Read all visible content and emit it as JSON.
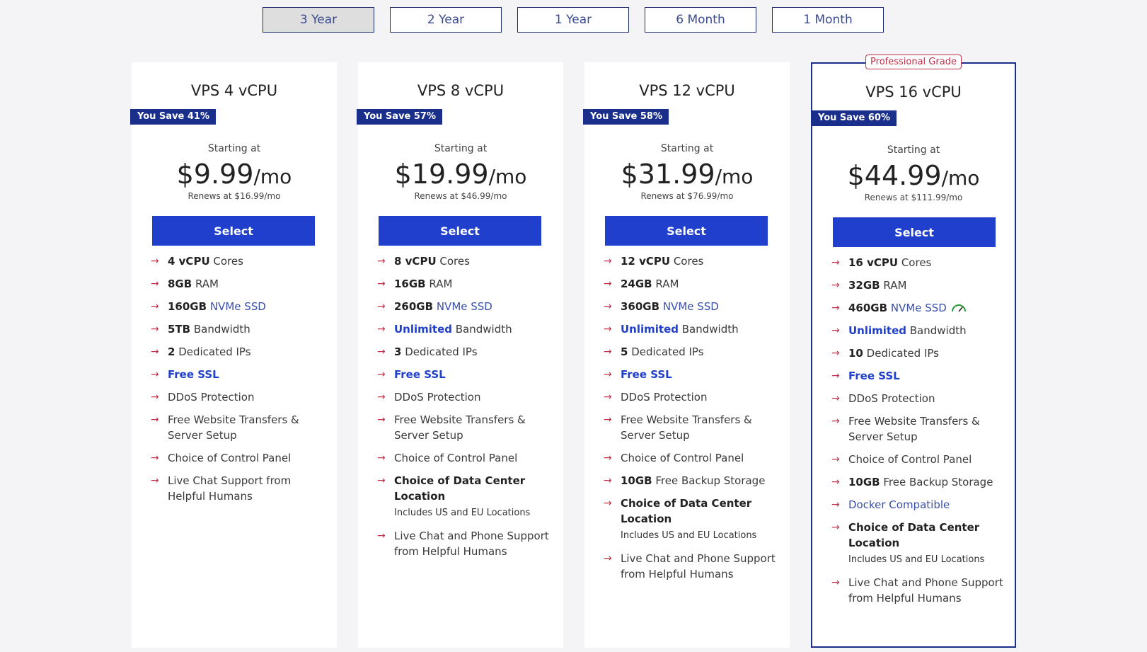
{
  "tabs": [
    {
      "label": "3 Year",
      "active": true
    },
    {
      "label": "2 Year",
      "active": false
    },
    {
      "label": "1 Year",
      "active": false
    },
    {
      "label": "6 Month",
      "active": false
    },
    {
      "label": "1 Month",
      "active": false
    }
  ],
  "plans": [
    {
      "title": "VPS 4 vCPU",
      "save": "You Save 41%",
      "starting": "Starting at",
      "price": "$9.99",
      "per": "/mo",
      "renews": "Renews at $16.99/mo",
      "select": "Select",
      "features": [
        {
          "strong": "4 vCPU",
          "rest": " Cores"
        },
        {
          "strong": "8GB",
          "rest": " RAM"
        },
        {
          "strong": "160GB",
          "rest_blue": " NVMe SSD"
        },
        {
          "strong": "5TB",
          "rest": " Bandwidth"
        },
        {
          "strong": "2",
          "rest": " Dedicated IPs"
        },
        {
          "blue_bold": "Free SSL"
        },
        {
          "rest": "DDoS Protection"
        },
        {
          "rest": "Free Website Transfers & Server Setup"
        },
        {
          "rest": "Choice of Control Panel"
        },
        {
          "rest": "Live Chat Support from Helpful Humans"
        }
      ]
    },
    {
      "title": "VPS 8 vCPU",
      "save": "You Save 57%",
      "starting": "Starting at",
      "price": "$19.99",
      "per": "/mo",
      "renews": "Renews at $46.99/mo",
      "select": "Select",
      "features": [
        {
          "strong": "8 vCPU",
          "rest": " Cores"
        },
        {
          "strong": "16GB",
          "rest": " RAM"
        },
        {
          "strong": "260GB",
          "rest_blue": " NVMe SSD"
        },
        {
          "blue_bold": "Unlimited",
          "rest": " Bandwidth"
        },
        {
          "strong": "3",
          "rest": " Dedicated IPs"
        },
        {
          "blue_bold": "Free SSL"
        },
        {
          "rest": "DDoS Protection"
        },
        {
          "rest": "Free Website Transfers & Server Setup"
        },
        {
          "rest": "Choice of Control Panel"
        },
        {
          "strong": "Choice of Data Center Location",
          "sub": "Includes US and EU Locations"
        },
        {
          "rest": "Live Chat and Phone Support from Helpful Humans"
        }
      ]
    },
    {
      "title": "VPS 12 vCPU",
      "save": "You Save 58%",
      "starting": "Starting at",
      "price": "$31.99",
      "per": "/mo",
      "renews": "Renews at $76.99/mo",
      "select": "Select",
      "features": [
        {
          "strong": "12 vCPU",
          "rest": " Cores"
        },
        {
          "strong": "24GB",
          "rest": " RAM"
        },
        {
          "strong": "360GB",
          "rest_blue": " NVMe SSD"
        },
        {
          "blue_bold": "Unlimited",
          "rest": " Bandwidth"
        },
        {
          "strong": "5",
          "rest": " Dedicated IPs"
        },
        {
          "blue_bold": "Free SSL"
        },
        {
          "rest": "DDoS Protection"
        },
        {
          "rest": "Free Website Transfers & Server Setup"
        },
        {
          "rest": "Choice of Control Panel"
        },
        {
          "strong": "10GB",
          "rest": " Free Backup Storage"
        },
        {
          "strong": "Choice of Data Center Location",
          "sub": "Includes US and EU Locations"
        },
        {
          "rest": "Live Chat and Phone Support from Helpful Humans"
        }
      ]
    },
    {
      "title": "VPS 16 vCPU",
      "save": "You Save 60%",
      "badge": "Professional Grade",
      "starting": "Starting at",
      "price": "$44.99",
      "per": "/mo",
      "renews": "Renews at $111.99/mo",
      "select": "Select",
      "features": [
        {
          "strong": "16 vCPU",
          "rest": " Cores"
        },
        {
          "strong": "32GB",
          "rest": " RAM"
        },
        {
          "strong": "460GB",
          "rest_blue": " NVMe SSD",
          "icon": "speed-icon"
        },
        {
          "blue_bold": "Unlimited",
          "rest": " Bandwidth"
        },
        {
          "strong": "10",
          "rest": " Dedicated IPs"
        },
        {
          "blue_bold": "Free SSL"
        },
        {
          "rest": "DDoS Protection"
        },
        {
          "rest": "Free Website Transfers & Server Setup"
        },
        {
          "rest": "Choice of Control Panel"
        },
        {
          "strong": "10GB",
          "rest": " Free Backup Storage"
        },
        {
          "rest_blue": "Docker Compatible"
        },
        {
          "strong": "Choice of Data Center Location",
          "sub": "Includes US and EU Locations"
        },
        {
          "rest": "Live Chat and Phone Support from Helpful Humans"
        }
      ]
    }
  ],
  "colors": {
    "accent": "#1f3fcc",
    "badge": "#1a2f8c",
    "arrow": "#c0304a"
  },
  "icons": {
    "bullet": "arrow-right-icon",
    "ssd": "speed-icon"
  }
}
